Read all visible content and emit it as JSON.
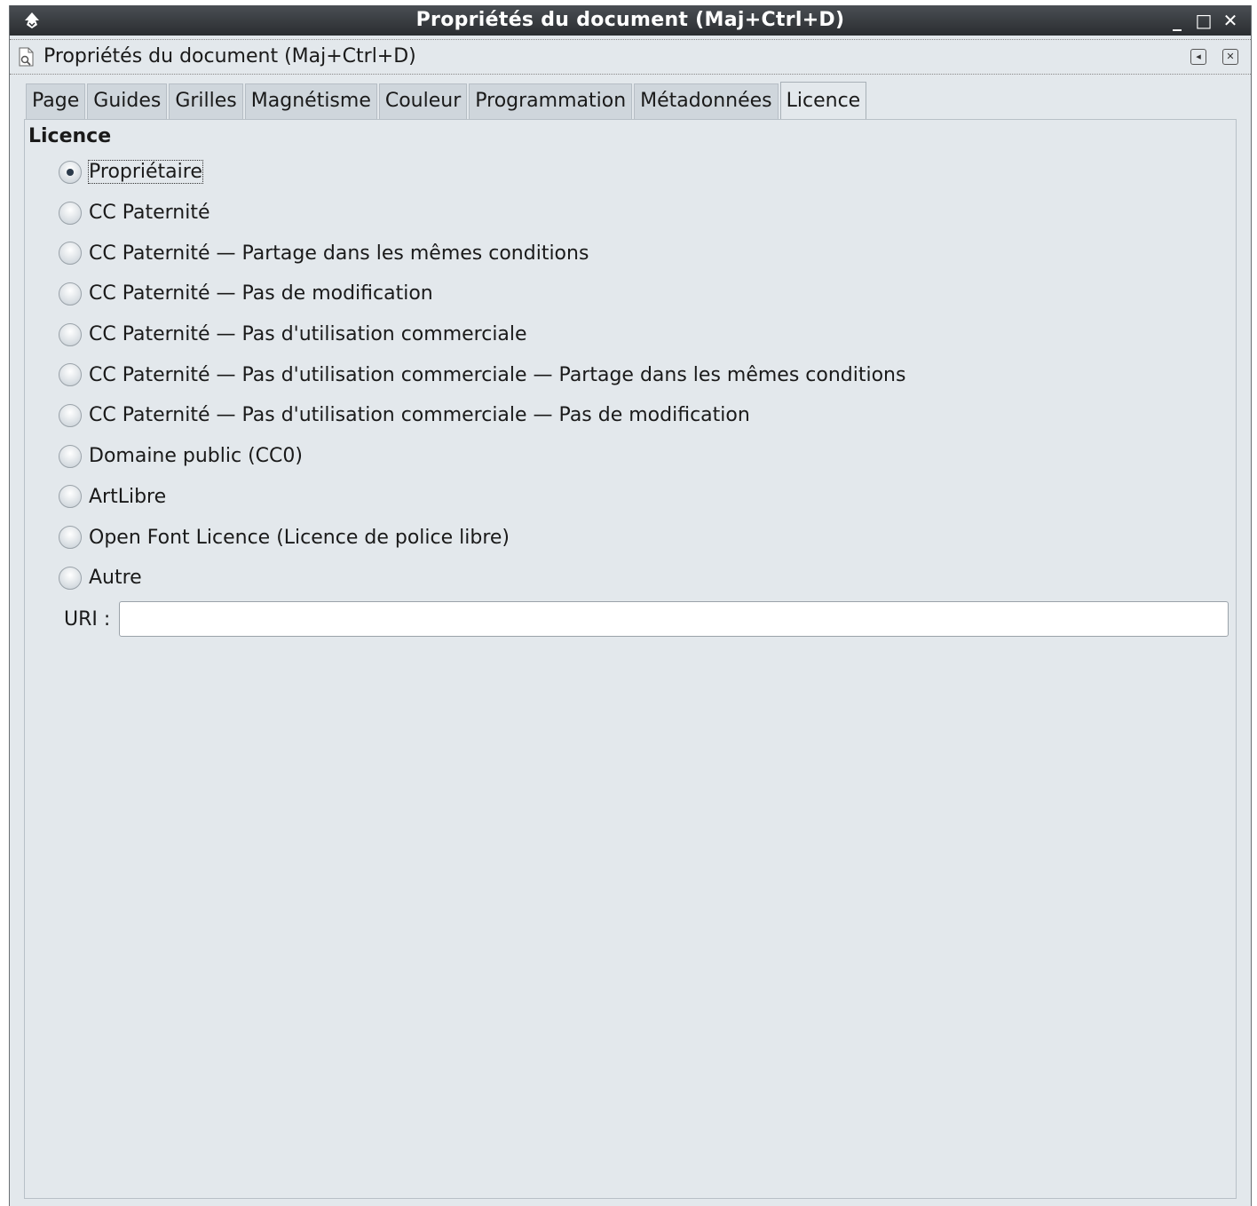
{
  "window": {
    "title": "Propriétés du document (Maj+Ctrl+D)",
    "controls": {
      "minimize": "_",
      "maximize": "□",
      "close": "✕"
    }
  },
  "dock": {
    "title": "Propriétés du document (Maj+Ctrl+D)",
    "iconify_label": "◂",
    "close_label": "✕"
  },
  "tabs": [
    {
      "label": "Page"
    },
    {
      "label": "Guides"
    },
    {
      "label": "Grilles"
    },
    {
      "label": "Magnétisme"
    },
    {
      "label": "Couleur"
    },
    {
      "label": "Programmation"
    },
    {
      "label": "Métadonnées"
    },
    {
      "label": "Licence",
      "active": true
    }
  ],
  "licence": {
    "section_title": "Licence",
    "options": [
      {
        "label": "Propriétaire",
        "checked": true
      },
      {
        "label": "CC Paternité"
      },
      {
        "label": "CC Paternité — Partage dans les mêmes conditions"
      },
      {
        "label": "CC Paternité — Pas de modification"
      },
      {
        "label": "CC Paternité — Pas d'utilisation commerciale"
      },
      {
        "label": "CC Paternité — Pas d'utilisation commerciale — Partage dans les mêmes conditions"
      },
      {
        "label": "CC Paternité — Pas d'utilisation commerciale — Pas de modification"
      },
      {
        "label": "Domaine public (CC0)"
      },
      {
        "label": "ArtLibre"
      },
      {
        "label": "Open Font Licence (Licence de police libre)"
      },
      {
        "label": "Autre"
      }
    ],
    "uri_label": "URI :",
    "uri_value": ""
  }
}
